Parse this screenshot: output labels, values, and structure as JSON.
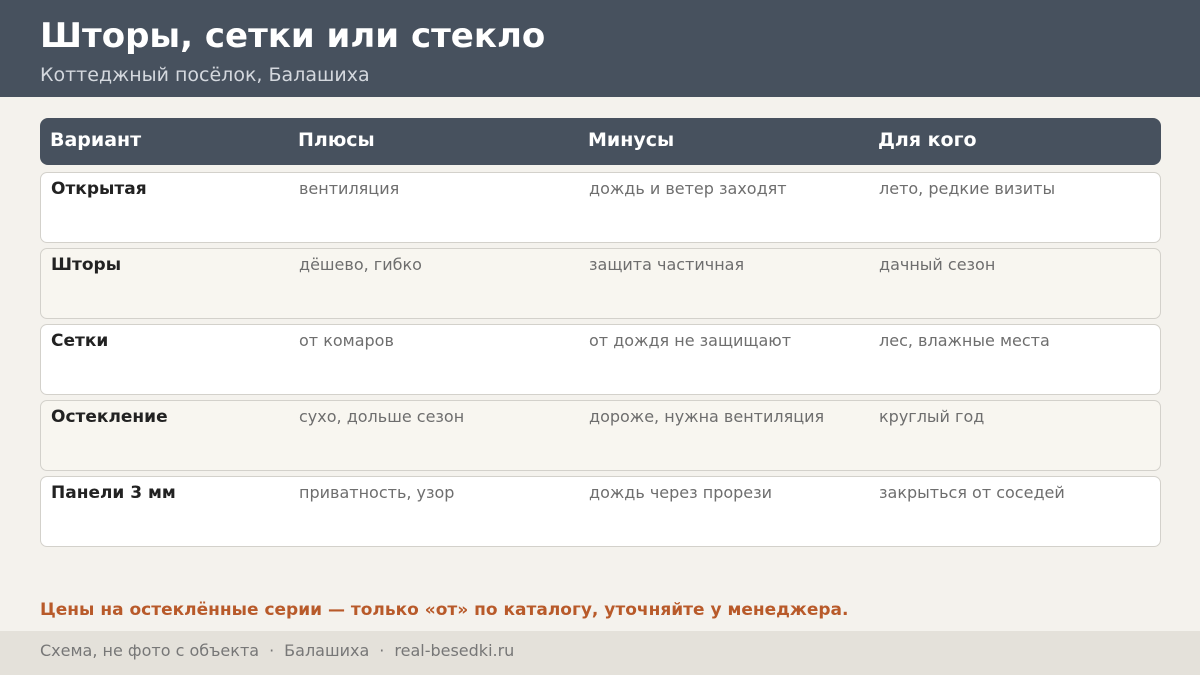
{
  "header": {
    "title": "Шторы, сетки или стекло",
    "subtitle": "Коттеджный посёлок, Балашиха"
  },
  "table": {
    "columns": [
      "Вариант",
      "Плюсы",
      "Минусы",
      "Для кого"
    ],
    "rows": [
      {
        "variant": "Открытая",
        "pros": "вентиляция",
        "cons": "дождь и ветер заходят",
        "for_whom": "лето, редкие визиты"
      },
      {
        "variant": "Шторы",
        "pros": "дёшево, гибко",
        "cons": "защита частичная",
        "for_whom": "дачный сезон"
      },
      {
        "variant": "Сетки",
        "pros": "от комаров",
        "cons": "от дождя не защищают",
        "for_whom": "лес, влажные места"
      },
      {
        "variant": "Остекление",
        "pros": "сухо, дольше сезон",
        "cons": "дороже, нужна вентиляция",
        "for_whom": "круглый год"
      },
      {
        "variant": "Панели 3 мм",
        "pros": "приватность, узор",
        "cons": "дождь через прорези",
        "for_whom": "закрыться от соседей"
      }
    ]
  },
  "note": "Цены на остеклённые серии — только «от» по каталогу, уточняйте у менеджера.",
  "footer": {
    "part1": "Схема, не фото с объекта",
    "separator": "·",
    "part2": "Балашиха",
    "part3": "real-besedki.ru"
  },
  "colors": {
    "header_bg": "#47515e",
    "accent_note": "#b85a2a",
    "page_bg": "#f4f2ed",
    "row_alt_bg": "#f8f6f0",
    "footer_bg": "#e4e1da"
  }
}
